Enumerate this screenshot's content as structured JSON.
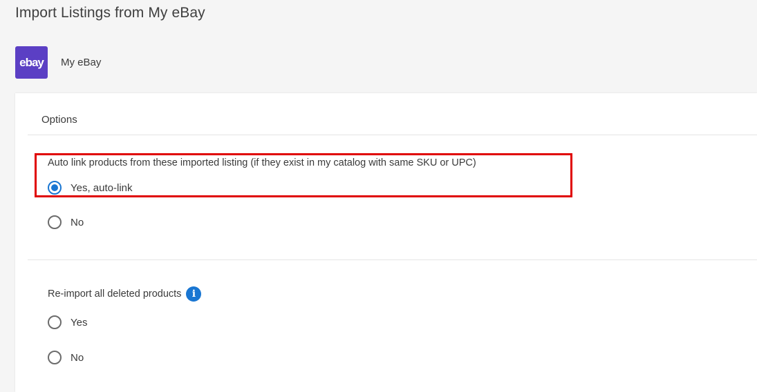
{
  "page": {
    "title": "Import Listings from My eBay"
  },
  "channel": {
    "logo_text": "ebay",
    "name": "My eBay",
    "logo_color": "#5b3fc4"
  },
  "options": {
    "header": "Options",
    "auto_link": {
      "question": "Auto link products from these imported listing (if they exist in my catalog with same SKU or UPC)",
      "choices": [
        {
          "label": "Yes, auto-link",
          "selected": true
        },
        {
          "label": "No",
          "selected": false
        }
      ]
    },
    "reimport": {
      "question": "Re-import all deleted products",
      "info_icon": "info-icon",
      "choices": [
        {
          "label": "Yes",
          "selected": false
        },
        {
          "label": "No",
          "selected": false
        }
      ]
    }
  },
  "colors": {
    "accent": "#1976d2",
    "highlight": "#e00000"
  }
}
